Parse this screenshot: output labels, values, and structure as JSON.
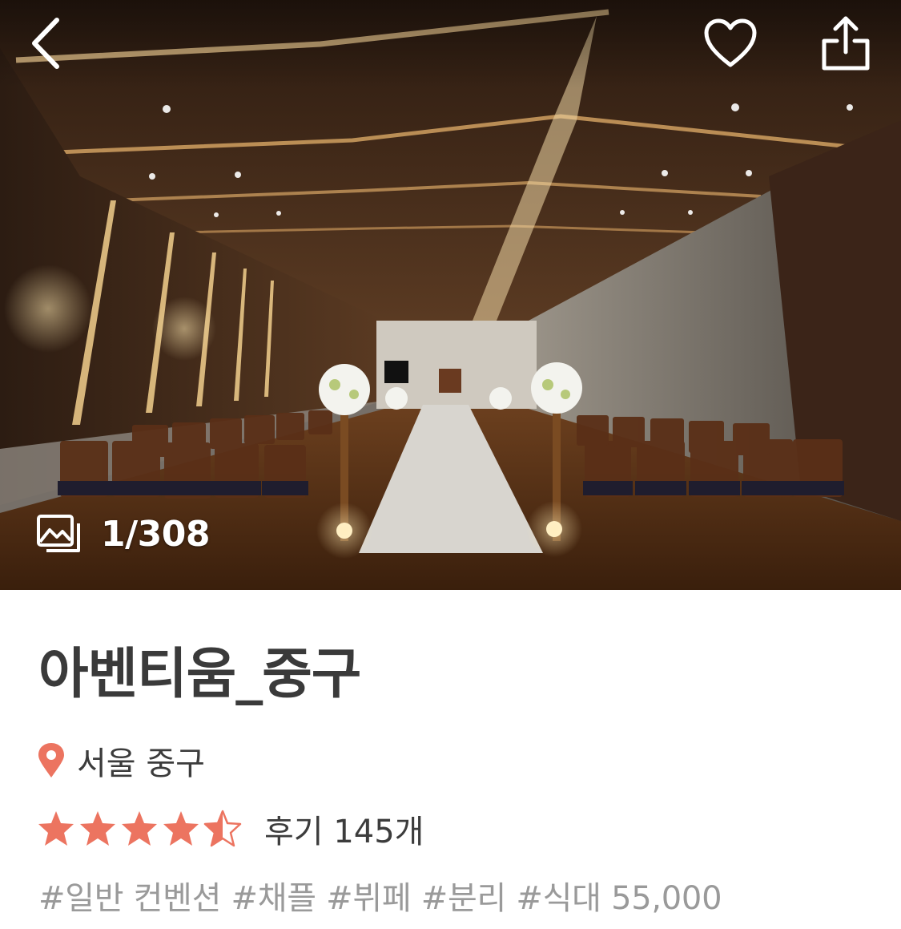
{
  "header": {
    "back_icon": "chevron-left-icon",
    "like_icon": "heart-outline-icon",
    "share_icon": "share-upload-icon"
  },
  "gallery": {
    "photo_counter": "1/308",
    "counter_icon": "photo-stack-icon"
  },
  "venue": {
    "name": "아벤티움_중구",
    "location": "서울 중구",
    "location_icon": "map-pin-icon",
    "rating": 4.5,
    "max_rating": 5,
    "review_count_label": "후기 145개",
    "tags": "#일반 컨벤션 #채플 #뷔페 #분리 #식대 55,000"
  },
  "colors": {
    "accent": "#ec7460",
    "title_text": "#3a3a3a",
    "tag_text": "#9a9a9a"
  }
}
